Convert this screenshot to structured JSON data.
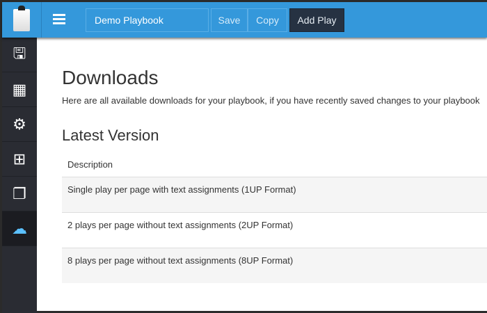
{
  "header": {
    "playbook_name": "Demo Playbook",
    "save": "Save",
    "copy": "Copy",
    "add_play": "Add Play"
  },
  "sidebar": {
    "items": [
      {
        "icon": "save-icon",
        "glyph": "💾"
      },
      {
        "icon": "grid-icon",
        "glyph": "▦"
      },
      {
        "icon": "gear-icon",
        "glyph": "⚙"
      },
      {
        "icon": "plus-square-icon",
        "glyph": "⊞"
      },
      {
        "icon": "copy-file-icon",
        "glyph": "❐"
      },
      {
        "icon": "cloud-download-icon",
        "glyph": "☁",
        "active": true
      }
    ]
  },
  "main": {
    "title": "Downloads",
    "intro": "Here are all available downloads for your playbook, if you have recently saved changes to your playbook",
    "section": "Latest Version",
    "table": {
      "header": "Description",
      "rows": [
        "Single play per page with text assignments (1UP Format)",
        "2 plays per page without text assignments (2UP Format)",
        "8 plays per page without text assignments (8UP Format)"
      ]
    }
  },
  "colors": {
    "topbar": "#3498db",
    "sidebar": "#2a2c33",
    "active_icon": "#5bc0ff"
  }
}
